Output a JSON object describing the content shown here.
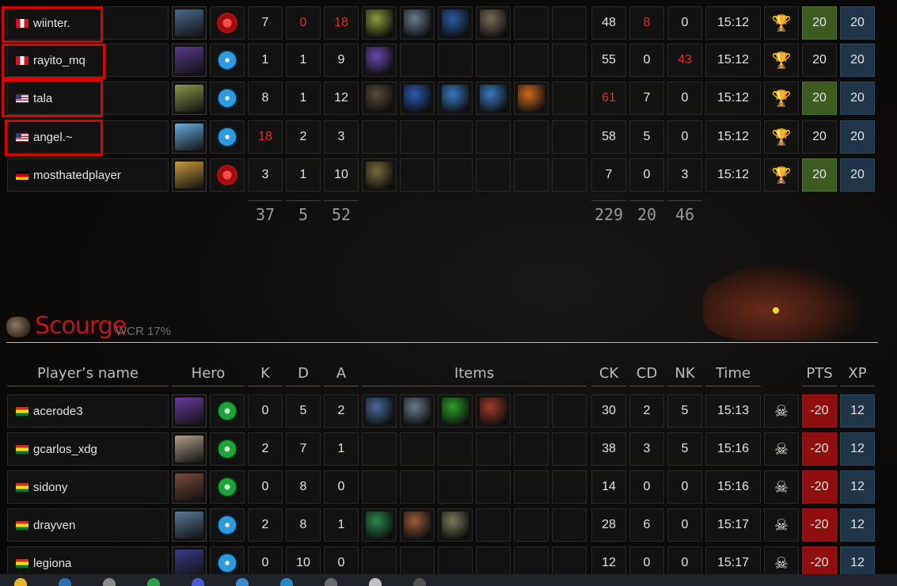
{
  "sentinel_players": [
    {
      "name": "wiinter.",
      "flag": "pe",
      "hero_color": "#4a6b8c",
      "side": "sentinel-r",
      "k": "7",
      "d": "0",
      "a": "18",
      "d_red": true,
      "a_red": true,
      "k_red": false,
      "items": [
        "#8a9a3a",
        "#6b7a8c",
        "#2a5aa0",
        "#7a6a5a",
        "",
        ""
      ],
      "ck": "48",
      "cd": "8",
      "nk": "0",
      "cd_red": true,
      "ck_red": false,
      "nk_red": false,
      "time": "15:12",
      "result": "🏆",
      "pts": "20",
      "pts_type": "pos",
      "xp": "20"
    },
    {
      "name": "rayito_mq",
      "flag": "pe",
      "hero_color": "#5a3a8c",
      "side": "blue",
      "k": "1",
      "d": "1",
      "a": "9",
      "k_red": false,
      "d_red": false,
      "a_red": false,
      "items": [
        "#6a4ab0",
        "",
        "",
        "",
        "",
        ""
      ],
      "ck": "55",
      "cd": "0",
      "nk": "43",
      "ck_red": false,
      "cd_red": false,
      "nk_red": true,
      "time": "15:12",
      "result": "🏆",
      "pts": "20",
      "pts_type": "neutral",
      "xp": "20"
    },
    {
      "name": "tala",
      "flag": "us",
      "hero_color": "#8a9a4a",
      "side": "blue",
      "k": "8",
      "d": "1",
      "a": "12",
      "k_red": false,
      "d_red": false,
      "a_red": false,
      "items": [
        "#5a4a3a",
        "#2a5ab0",
        "#3a7ac0",
        "#3a7ac0",
        "#d06a1a",
        ""
      ],
      "ck": "61",
      "cd": "7",
      "nk": "0",
      "ck_red": true,
      "cd_red": false,
      "nk_red": false,
      "time": "15:12",
      "result": "🏆",
      "pts": "20",
      "pts_type": "pos",
      "xp": "20"
    },
    {
      "name": "angel.~",
      "flag": "us",
      "hero_color": "#6aaee0",
      "side": "blue",
      "k": "18",
      "d": "2",
      "a": "3",
      "k_red": true,
      "d_red": false,
      "a_red": false,
      "items": [
        "",
        "",
        "",
        "",
        "",
        ""
      ],
      "ck": "58",
      "cd": "5",
      "nk": "0",
      "ck_red": false,
      "cd_red": false,
      "nk_red": false,
      "time": "15:12",
      "result": "🏆",
      "pts": "20",
      "pts_type": "neutral",
      "xp": "20"
    },
    {
      "name": "mosthatedplayer",
      "flag": "de",
      "hero_color": "#c89a3a",
      "side": "sentinel-r",
      "k": "3",
      "d": "1",
      "a": "10",
      "k_red": false,
      "d_red": false,
      "a_red": false,
      "items": [
        "#7a6a3a",
        "",
        "",
        "",
        "",
        ""
      ],
      "ck": "7",
      "cd": "0",
      "nk": "3",
      "ck_red": false,
      "cd_red": false,
      "nk_red": false,
      "time": "15:12",
      "result": "🏆",
      "pts": "20",
      "pts_type": "pos",
      "xp": "20"
    }
  ],
  "sentinel_totals": {
    "k": "37",
    "d": "5",
    "a": "52",
    "ck": "229",
    "cd": "20",
    "nk": "46"
  },
  "scourge": {
    "title": "Scourge",
    "wcr": "WCR 17%"
  },
  "headers": {
    "name": "Player’s name",
    "hero": "Hero",
    "k": "K",
    "d": "D",
    "a": "A",
    "items": "Items",
    "ck": "CK",
    "cd": "CD",
    "nk": "NK",
    "time": "Time",
    "pts": "PTS",
    "xp": "XP"
  },
  "scourge_players": [
    {
      "name": "acerode3",
      "flag": "bo",
      "hero_color": "#6a3aa0",
      "side": "green",
      "k": "0",
      "d": "5",
      "a": "2",
      "items": [
        "#4a6a9a",
        "#6a7a8c",
        "#2aa02a",
        "#a03a2a",
        "",
        ""
      ],
      "ck": "30",
      "cd": "2",
      "nk": "5",
      "time": "15:13",
      "result": "☠",
      "pts": "-20",
      "xp": "12"
    },
    {
      "name": "gcarlos_xdg",
      "flag": "bo",
      "hero_color": "#b0a08a",
      "side": "green",
      "k": "2",
      "d": "7",
      "a": "1",
      "items": [
        "",
        "",
        "",
        "",
        "",
        ""
      ],
      "ck": "38",
      "cd": "3",
      "nk": "5",
      "time": "15:16",
      "result": "☠",
      "pts": "-20",
      "xp": "12"
    },
    {
      "name": "sidony",
      "flag": "bo",
      "hero_color": "#7a4a3a",
      "side": "green",
      "k": "0",
      "d": "8",
      "a": "0",
      "items": [
        "",
        "",
        "",
        "",
        "",
        ""
      ],
      "ck": "14",
      "cd": "0",
      "nk": "0",
      "time": "15:16",
      "result": "☠",
      "pts": "-20",
      "xp": "12"
    },
    {
      "name": "drayven",
      "flag": "bo",
      "hero_color": "#5a7a9a",
      "side": "blue",
      "k": "2",
      "d": "8",
      "a": "1",
      "items": [
        "#2a8a4a",
        "#9a5a3a",
        "#7a7a5a",
        "",
        "",
        ""
      ],
      "ck": "28",
      "cd": "6",
      "nk": "0",
      "time": "15:17",
      "result": "☠",
      "pts": "-20",
      "xp": "12"
    },
    {
      "name": "legiona",
      "flag": "bo",
      "hero_color": "#3a3a8a",
      "side": "blue",
      "k": "0",
      "d": "10",
      "a": "0",
      "items": [
        "",
        "",
        "",
        "",
        "",
        ""
      ],
      "ck": "12",
      "cd": "0",
      "nk": "0",
      "time": "15:17",
      "result": "☠",
      "pts": "-20",
      "xp": "12"
    }
  ]
}
